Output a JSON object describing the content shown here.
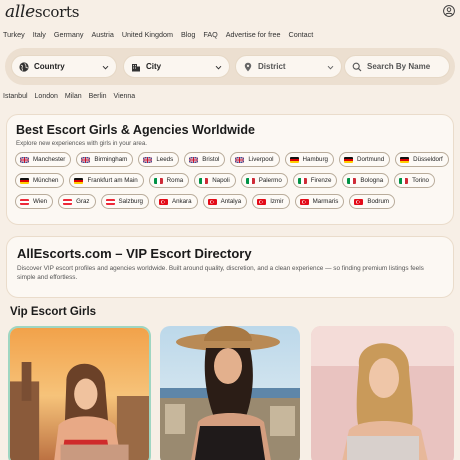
{
  "header": {
    "logo_prefix": "alle",
    "logo_suffix": "scorts"
  },
  "nav": [
    "Turkey",
    "Italy",
    "Germany",
    "Austria",
    "United Kingdom",
    "Blog",
    "FAQ",
    "Advertise for free",
    "Contact"
  ],
  "filters": {
    "country": "Country",
    "city": "City",
    "district": "District",
    "search_placeholder": "Search By Name"
  },
  "popular_cities": [
    "Istanbul",
    "London",
    "Milan",
    "Berlin",
    "Vienna"
  ],
  "best_section": {
    "title": "Best Escort Girls & Agencies Worldwide",
    "subtitle": "Explore new experiences with girls in your area.",
    "rows": [
      [
        {
          "name": "Manchester",
          "flag": "uk"
        },
        {
          "name": "Birmingham",
          "flag": "uk"
        },
        {
          "name": "Leeds",
          "flag": "uk"
        },
        {
          "name": "Bristol",
          "flag": "uk"
        },
        {
          "name": "Liverpool",
          "flag": "uk"
        },
        {
          "name": "Hamburg",
          "flag": "de"
        },
        {
          "name": "Dortmund",
          "flag": "de"
        },
        {
          "name": "Düsseldorf",
          "flag": "de"
        }
      ],
      [
        {
          "name": "München",
          "flag": "de"
        },
        {
          "name": "Frankfurt am Main",
          "flag": "de"
        },
        {
          "name": "Roma",
          "flag": "it"
        },
        {
          "name": "Napoli",
          "flag": "it"
        },
        {
          "name": "Palermo",
          "flag": "it"
        },
        {
          "name": "Firenze",
          "flag": "it"
        },
        {
          "name": "Bologna",
          "flag": "it"
        },
        {
          "name": "Torino",
          "flag": "it"
        }
      ],
      [
        {
          "name": "Wien",
          "flag": "at"
        },
        {
          "name": "Graz",
          "flag": "at"
        },
        {
          "name": "Salzburg",
          "flag": "at"
        },
        {
          "name": "Ankara",
          "flag": "tr"
        },
        {
          "name": "Antalya",
          "flag": "tr"
        },
        {
          "name": "Izmir",
          "flag": "tr"
        },
        {
          "name": "Marmaris",
          "flag": "tr"
        },
        {
          "name": "Bodrum",
          "flag": "tr"
        }
      ]
    ]
  },
  "directory": {
    "title": "AllEscorts.com – VIP Escort Directory",
    "text": "Discover VIP escort profiles and agencies worldwide. Built around quality, discretion, and a clean experience — so finding premium listings feels simple and effortless."
  },
  "vip_title": "Vip Escort Girls",
  "icons": {
    "user": "user-icon",
    "country": "globe-icon",
    "city": "building-icon",
    "district": "location-pin-icon",
    "search": "search-icon",
    "chevron": "chevron-down-icon"
  },
  "colors": {
    "background": "#f7efe6",
    "filter_bar": "#ecdfd0",
    "card": "#fcf8f3",
    "featured_border": "#9fd6c2"
  }
}
